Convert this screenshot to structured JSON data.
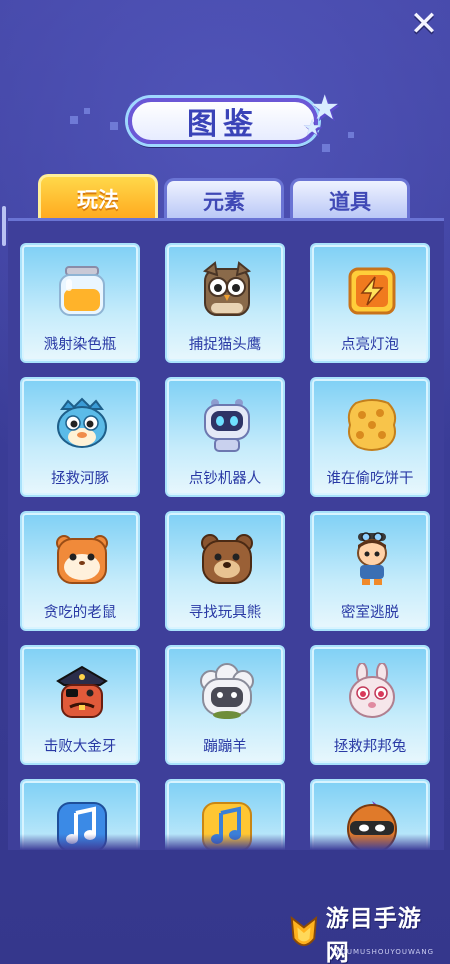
{
  "header": {
    "title": "图鉴",
    "close_icon": "close-icon"
  },
  "tabs": [
    {
      "label": "玩法",
      "active": true
    },
    {
      "label": "元素",
      "active": false
    },
    {
      "label": "道具",
      "active": false
    }
  ],
  "colors": {
    "background": "#3e3f9b",
    "active_tab": "#ffb52a",
    "card": "#a9e2fb",
    "label": "#2a3aa5"
  },
  "cards": [
    {
      "label": "溅射染色瓶",
      "icon": "jar-icon"
    },
    {
      "label": "捕捉猫头鹰",
      "icon": "owl-icon"
    },
    {
      "label": "点亮灯泡",
      "icon": "lightning-icon"
    },
    {
      "label": "拯救河豚",
      "icon": "pufferfish-icon"
    },
    {
      "label": "点钞机器人",
      "icon": "robot-icon"
    },
    {
      "label": "谁在偷吃饼干",
      "icon": "cookie-icon"
    },
    {
      "label": "贪吃的老鼠",
      "icon": "hamster-icon"
    },
    {
      "label": "寻找玩具熊",
      "icon": "bear-icon"
    },
    {
      "label": "密室逃脱",
      "icon": "adventurer-icon"
    },
    {
      "label": "击败大金牙",
      "icon": "pirate-icon"
    },
    {
      "label": "蹦蹦羊",
      "icon": "sheep-icon"
    },
    {
      "label": "拯救邦邦兔",
      "icon": "rabbit-icon"
    },
    {
      "label": "",
      "icon": "music-note-blue-icon"
    },
    {
      "label": "",
      "icon": "music-note-yellow-icon"
    },
    {
      "label": "",
      "icon": "ninja-icon"
    }
  ],
  "watermark": {
    "text": "游目手游网",
    "sub": "YOUMUSHOUYOUWANG"
  }
}
